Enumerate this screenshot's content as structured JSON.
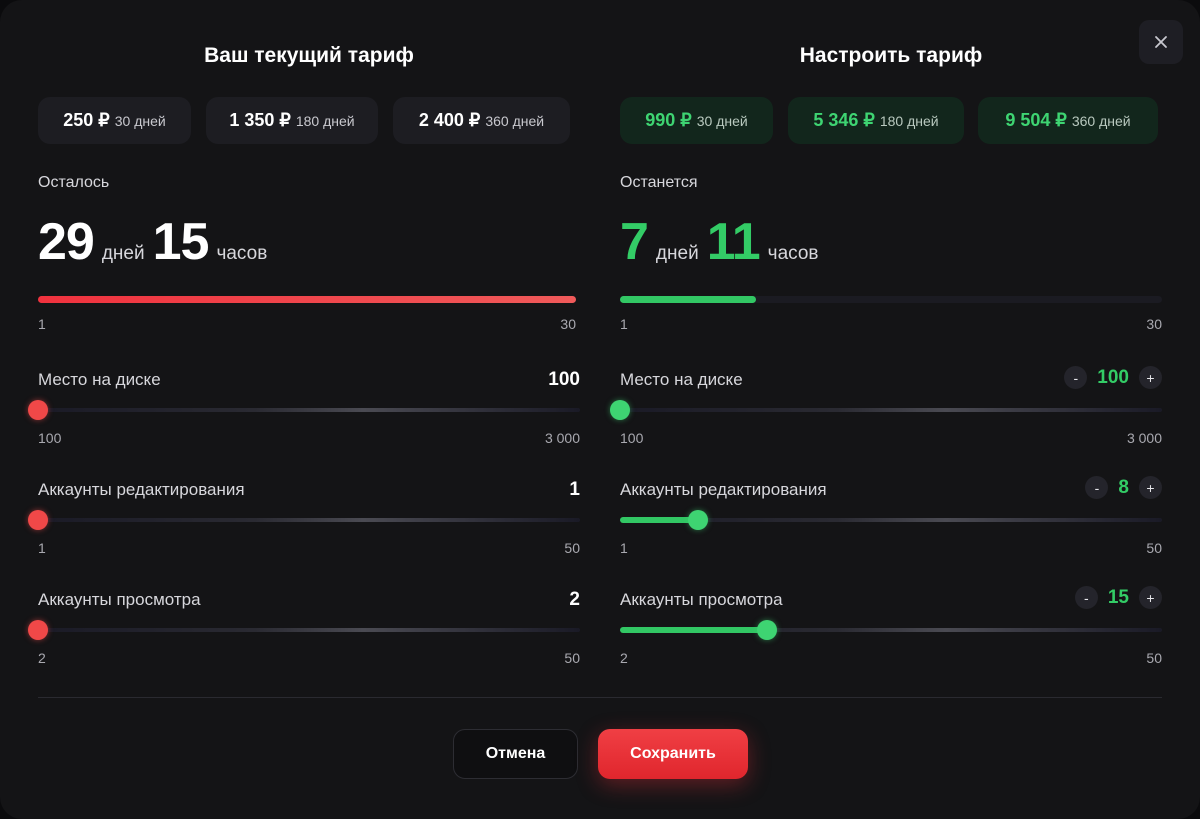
{
  "current": {
    "title": "Ваш текущий тариф",
    "plans": [
      {
        "price": "250 ₽",
        "period": "30 дней"
      },
      {
        "price": "1 350 ₽",
        "period": "180 дней"
      },
      {
        "price": "2 400 ₽",
        "period": "360 дней"
      }
    ],
    "remain_label": "Осталось",
    "days": "29",
    "days_unit": "дней",
    "hours": "15",
    "hours_unit": "часов",
    "progress": 1.0,
    "progress_min": "1",
    "progress_max": "30",
    "sliders": [
      {
        "label": "Место на диске",
        "value": "100",
        "min": "100",
        "max": "3 000",
        "fraction": 0
      },
      {
        "label": "Аккаунты редактирования",
        "value": "1",
        "min": "1",
        "max": "50",
        "fraction": 0
      },
      {
        "label": "Аккаунты просмотра",
        "value": "2",
        "min": "2",
        "max": "50",
        "fraction": 0
      }
    ]
  },
  "custom": {
    "title": "Настроить тариф",
    "plans": [
      {
        "price": "990 ₽",
        "period": "30 дней"
      },
      {
        "price": "5 346 ₽",
        "period": "180 дней"
      },
      {
        "price": "9 504 ₽",
        "period": "360 дней"
      }
    ],
    "remain_label": "Останется",
    "days": "7",
    "days_unit": "дней",
    "hours": "11",
    "hours_unit": "часов",
    "progress": 0.25,
    "progress_min": "1",
    "progress_max": "30",
    "sliders": [
      {
        "label": "Место на диске",
        "value": "100",
        "min": "100",
        "max": "3 000",
        "fraction": 0
      },
      {
        "label": "Аккаунты редактирования",
        "value": "8",
        "min": "1",
        "max": "50",
        "fraction": 0.143
      },
      {
        "label": "Аккаунты просмотра",
        "value": "15",
        "min": "2",
        "max": "50",
        "fraction": 0.271
      }
    ],
    "stepper_minus": "-",
    "stepper_plus": "+"
  },
  "actions": {
    "cancel_label": "Отмена",
    "save_label": "Сохранить"
  },
  "colors": {
    "accent_red": "#f04848",
    "accent_green": "#33cc66",
    "background": "#141416"
  }
}
